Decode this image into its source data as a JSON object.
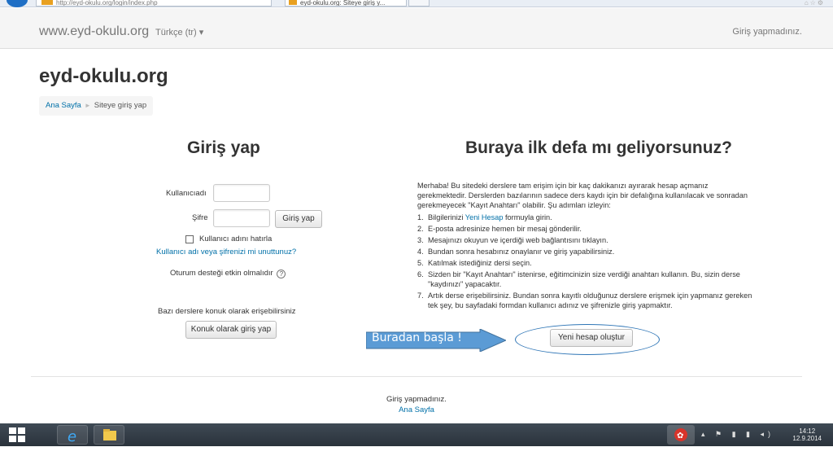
{
  "browser": {
    "address": "http://eyd-okulu.org/login/index.php",
    "tab_title": "eyd-okulu.org: Siteye giriş y..."
  },
  "navbar": {
    "brand": "www.eyd-okulu.org",
    "language": "Türkçe (tr) ▾",
    "login_status": "Giriş yapmadınız."
  },
  "page": {
    "site_title": "eyd-okulu.org",
    "breadcrumb": [
      "Ana Sayfa",
      "Siteye giriş yap"
    ]
  },
  "login": {
    "heading": "Giriş yap",
    "username_label": "Kullanıcıadı",
    "password_label": "Şifre",
    "login_button": "Giriş yap",
    "remember_label": "Kullanıcı adını hatırla",
    "forgot_link": "Kullanıcı adı veya şifrenizi mi unuttunuz?",
    "cookies_note": "Oturum desteği etkin olmalıdır",
    "guest_note": "Bazı derslere konuk olarak erişebilirsiniz",
    "guest_button": "Konuk olarak giriş yap"
  },
  "signup": {
    "heading": "Buraya ilk defa mı geliyorsunuz?",
    "intro": "Merhaba! Bu sitedeki derslere tam erişim için bir kaç dakikanızı ayırarak hesap açmanız gerekmektedir. Derslerden bazılarının sadece ders kaydı için bir defalığına kullanılacak ve sonradan gerekmeyecek \"Kayıt Anahtarı\" olabilir. Şu adımları izleyin:",
    "steps": [
      {
        "num": "1.",
        "before": "Bilgilerinizi ",
        "link": "Yeni Hesap",
        "after": " formuyla girin."
      },
      {
        "num": "2.",
        "before": "E-posta adresinize hemen bir mesaj gönderilir.",
        "link": "",
        "after": ""
      },
      {
        "num": "3.",
        "before": "Mesajınızı okuyun ve içerdiği web bağlantısını tıklayın.",
        "link": "",
        "after": ""
      },
      {
        "num": "4.",
        "before": "Bundan sonra hesabınız onaylanır ve giriş yapabilirsiniz.",
        "link": "",
        "after": ""
      },
      {
        "num": "5.",
        "before": "Katılmak istediğiniz dersi seçin.",
        "link": "",
        "after": ""
      },
      {
        "num": "6.",
        "before": "Sizden bir \"Kayıt Anahtarı\" istenirse, eğitimcinizin size verdiği anahtarı kullanın. Bu, sizin derse \"kaydınızı\" yapacaktır.",
        "link": "",
        "after": ""
      },
      {
        "num": "7.",
        "before": "Artık derse erişebilirsiniz. Bundan sonra kayıtlı olduğunuz derslere erişmek için yapmanız gereken tek şey, bu sayfadaki formdan kullanıcı adınız ve şifrenizle giriş yapmaktır.",
        "link": "",
        "after": ""
      }
    ],
    "create_button": "Yeni hesap oluştur"
  },
  "annotation": {
    "callout_text": "Buradan başla !",
    "callout_color": "#5b9bd5",
    "oval_color": "#2e75b6"
  },
  "footer": {
    "login_status": "Giriş yapmadınız.",
    "home_link": "Ana Sayfa"
  },
  "taskbar": {
    "time": "14:12",
    "date": "12.9.2014",
    "items": [
      "windows-start-icon",
      "internet-explorer-icon",
      "file-explorer-icon"
    ]
  },
  "colors": {
    "link": "#0070a8",
    "navbar_bg": "#f5f5f5",
    "taskbar_bg": "#2a323b"
  }
}
